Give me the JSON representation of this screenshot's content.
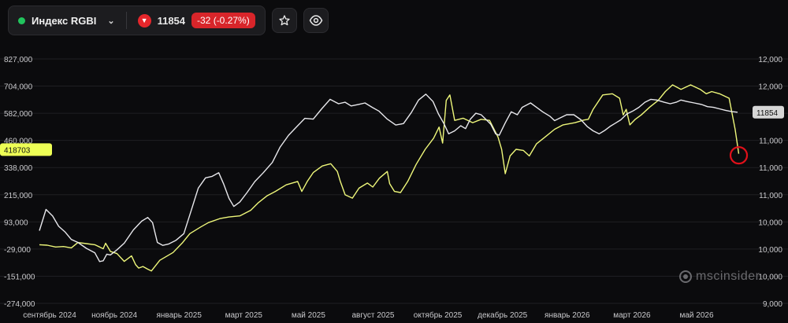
{
  "header": {
    "instrument_name": "Индекс RGBI",
    "status_color": "#21c45d",
    "dropdown_icon": "chevron-down-icon",
    "last_price": "11854",
    "change_text": "-32 (-0.27%)",
    "change_direction_icon": "triangle-down-icon",
    "favorite_icon": "star-icon",
    "watch_icon": "eye-icon",
    "down_color": "#e5262b"
  },
  "watermark": {
    "text": "mscinsider",
    "icon": "msc-logo-icon"
  },
  "chart_data": {
    "type": "line",
    "title": "",
    "x_labels": [
      "сентябрь 2024",
      "ноябрь 2024",
      "январь 2025",
      "март 2025",
      "май 2025",
      "август 2025",
      "октябрь 2025",
      "декабрь 2025",
      "январь 2026",
      "март 2026",
      "май 2026"
    ],
    "left_axis": {
      "ticks": [
        "827,000",
        "704,000",
        "582,000",
        "460,000",
        "338,000",
        "215,000",
        "93,000",
        "-29,000",
        "-151,000",
        "-274,000"
      ],
      "range": [
        -274000,
        827000
      ]
    },
    "right_axis": {
      "ticks": [
        "12,000",
        "12,000",
        "12,000",
        "11,000",
        "11,000",
        "11,000",
        "10,000",
        "10,000",
        "10,000",
        "9,000"
      ],
      "range": [
        9250,
        12580
      ]
    },
    "left_marker": {
      "label": "418703",
      "value": 418703,
      "color": "#eeff55"
    },
    "right_marker": {
      "label": "11854",
      "value": 11854,
      "color": "#d6d6d6"
    },
    "highlight": {
      "shape": "circle",
      "color": "#e0101a",
      "at": "last point"
    },
    "grid": "horizontal",
    "series": [
      {
        "axis": "left",
        "color": "#eef77a",
        "points": [
          [
            0.0,
            -10000
          ],
          [
            0.013,
            -12000
          ],
          [
            0.027,
            -20000
          ],
          [
            0.04,
            -18000
          ],
          [
            0.053,
            -24000
          ],
          [
            0.064,
            0
          ],
          [
            0.078,
            -5000
          ],
          [
            0.092,
            -10000
          ],
          [
            0.106,
            -28000
          ],
          [
            0.11,
            -3000
          ],
          [
            0.118,
            -40000
          ],
          [
            0.129,
            -50000
          ],
          [
            0.141,
            -85000
          ],
          [
            0.153,
            -60000
          ],
          [
            0.16,
            -100000
          ],
          [
            0.165,
            -115000
          ],
          [
            0.172,
            -108000
          ],
          [
            0.18,
            -120000
          ],
          [
            0.186,
            -128000
          ],
          [
            0.2,
            -80000
          ],
          [
            0.222,
            -45000
          ],
          [
            0.238,
            0
          ],
          [
            0.25,
            40000
          ],
          [
            0.268,
            70000
          ],
          [
            0.281,
            90000
          ],
          [
            0.3,
            108000
          ],
          [
            0.315,
            115000
          ],
          [
            0.333,
            120000
          ],
          [
            0.351,
            145000
          ],
          [
            0.364,
            180000
          ],
          [
            0.378,
            210000
          ],
          [
            0.392,
            230000
          ],
          [
            0.41,
            260000
          ],
          [
            0.429,
            275000
          ],
          [
            0.436,
            230000
          ],
          [
            0.445,
            275000
          ],
          [
            0.455,
            315000
          ],
          [
            0.47,
            345000
          ],
          [
            0.484,
            355000
          ],
          [
            0.495,
            320000
          ],
          [
            0.5,
            275000
          ],
          [
            0.508,
            215000
          ],
          [
            0.52,
            200000
          ],
          [
            0.531,
            245000
          ],
          [
            0.545,
            268000
          ],
          [
            0.554,
            250000
          ],
          [
            0.565,
            290000
          ],
          [
            0.578,
            320000
          ],
          [
            0.582,
            265000
          ],
          [
            0.59,
            230000
          ],
          [
            0.6,
            225000
          ],
          [
            0.612,
            275000
          ],
          [
            0.626,
            352000
          ],
          [
            0.641,
            420000
          ],
          [
            0.655,
            470000
          ],
          [
            0.664,
            520000
          ],
          [
            0.67,
            448000
          ],
          [
            0.676,
            640000
          ],
          [
            0.682,
            665000
          ],
          [
            0.69,
            550000
          ],
          [
            0.704,
            560000
          ],
          [
            0.72,
            540000
          ],
          [
            0.734,
            555000
          ],
          [
            0.748,
            550000
          ],
          [
            0.762,
            475000
          ],
          [
            0.768,
            420000
          ],
          [
            0.774,
            310000
          ],
          [
            0.782,
            390000
          ],
          [
            0.792,
            420000
          ],
          [
            0.804,
            415000
          ],
          [
            0.814,
            390000
          ],
          [
            0.826,
            445000
          ],
          [
            0.84,
            475000
          ],
          [
            0.856,
            510000
          ],
          [
            0.87,
            530000
          ],
          [
            0.89,
            540000
          ],
          [
            0.905,
            552000
          ],
          [
            0.912,
            555000
          ],
          [
            0.92,
            600000
          ],
          [
            0.936,
            665000
          ],
          [
            0.952,
            670000
          ],
          [
            0.964,
            650000
          ],
          [
            0.97,
            575000
          ],
          [
            0.975,
            600000
          ],
          [
            0.981,
            530000
          ],
          [
            0.99,
            555000
          ],
          [
            1.0,
            575000
          ],
          [
            1.014,
            610000
          ],
          [
            1.028,
            640000
          ],
          [
            1.04,
            680000
          ],
          [
            1.052,
            710000
          ],
          [
            1.066,
            690000
          ],
          [
            1.082,
            710000
          ],
          [
            1.098,
            690000
          ],
          [
            1.108,
            670000
          ],
          [
            1.117,
            680000
          ],
          [
            1.13,
            670000
          ],
          [
            1.146,
            650000
          ],
          [
            1.156,
            510000
          ],
          [
            1.162,
            400000
          ]
        ]
      },
      {
        "axis": "right",
        "color": "#e8e8ec",
        "points": [
          [
            0.0,
            10240
          ],
          [
            0.011,
            10530
          ],
          [
            0.022,
            10440
          ],
          [
            0.032,
            10300
          ],
          [
            0.043,
            10220
          ],
          [
            0.053,
            10120
          ],
          [
            0.064,
            10080
          ],
          [
            0.078,
            10000
          ],
          [
            0.092,
            9940
          ],
          [
            0.1,
            9820
          ],
          [
            0.106,
            9830
          ],
          [
            0.112,
            9920
          ],
          [
            0.118,
            9910
          ],
          [
            0.129,
            9980
          ],
          [
            0.141,
            10070
          ],
          [
            0.156,
            10250
          ],
          [
            0.17,
            10370
          ],
          [
            0.18,
            10420
          ],
          [
            0.188,
            10350
          ],
          [
            0.196,
            10080
          ],
          [
            0.205,
            10040
          ],
          [
            0.215,
            10060
          ],
          [
            0.227,
            10110
          ],
          [
            0.24,
            10200
          ],
          [
            0.252,
            10510
          ],
          [
            0.264,
            10820
          ],
          [
            0.276,
            10960
          ],
          [
            0.287,
            10980
          ],
          [
            0.298,
            11030
          ],
          [
            0.306,
            10880
          ],
          [
            0.315,
            10680
          ],
          [
            0.323,
            10570
          ],
          [
            0.333,
            10630
          ],
          [
            0.345,
            10760
          ],
          [
            0.358,
            10910
          ],
          [
            0.372,
            11030
          ],
          [
            0.387,
            11170
          ],
          [
            0.4,
            11380
          ],
          [
            0.414,
            11540
          ],
          [
            0.428,
            11660
          ],
          [
            0.441,
            11770
          ],
          [
            0.455,
            11760
          ],
          [
            0.469,
            11900
          ],
          [
            0.483,
            12030
          ],
          [
            0.497,
            11970
          ],
          [
            0.508,
            11990
          ],
          [
            0.518,
            11940
          ],
          [
            0.53,
            11960
          ],
          [
            0.541,
            11980
          ],
          [
            0.553,
            11920
          ],
          [
            0.564,
            11870
          ],
          [
            0.578,
            11760
          ],
          [
            0.592,
            11680
          ],
          [
            0.605,
            11700
          ],
          [
            0.618,
            11850
          ],
          [
            0.63,
            12020
          ],
          [
            0.642,
            12100
          ],
          [
            0.654,
            12000
          ],
          [
            0.663,
            11830
          ],
          [
            0.672,
            11700
          ],
          [
            0.68,
            11560
          ],
          [
            0.69,
            11600
          ],
          [
            0.7,
            11670
          ],
          [
            0.708,
            11630
          ],
          [
            0.716,
            11760
          ],
          [
            0.725,
            11840
          ],
          [
            0.734,
            11820
          ],
          [
            0.744,
            11740
          ],
          [
            0.75,
            11690
          ],
          [
            0.758,
            11560
          ],
          [
            0.764,
            11540
          ],
          [
            0.774,
            11710
          ],
          [
            0.784,
            11860
          ],
          [
            0.794,
            11820
          ],
          [
            0.802,
            11920
          ],
          [
            0.816,
            11980
          ],
          [
            0.826,
            11920
          ],
          [
            0.836,
            11860
          ],
          [
            0.848,
            11800
          ],
          [
            0.856,
            11740
          ],
          [
            0.866,
            11780
          ],
          [
            0.876,
            11820
          ],
          [
            0.888,
            11820
          ],
          [
            0.9,
            11750
          ],
          [
            0.91,
            11660
          ],
          [
            0.92,
            11600
          ],
          [
            0.93,
            11560
          ],
          [
            0.94,
            11610
          ],
          [
            0.948,
            11660
          ],
          [
            0.956,
            11700
          ],
          [
            0.966,
            11750
          ],
          [
            0.976,
            11830
          ],
          [
            0.986,
            11870
          ],
          [
            0.996,
            11920
          ],
          [
            1.006,
            11990
          ],
          [
            1.016,
            12030
          ],
          [
            1.026,
            12020
          ],
          [
            1.038,
            11990
          ],
          [
            1.048,
            11970
          ],
          [
            1.058,
            11990
          ],
          [
            1.066,
            12020
          ],
          [
            1.076,
            12000
          ],
          [
            1.088,
            11980
          ],
          [
            1.1,
            11960
          ],
          [
            1.11,
            11930
          ],
          [
            1.12,
            11920
          ],
          [
            1.13,
            11900
          ],
          [
            1.14,
            11880
          ],
          [
            1.15,
            11864
          ],
          [
            1.16,
            11854
          ]
        ]
      }
    ]
  }
}
